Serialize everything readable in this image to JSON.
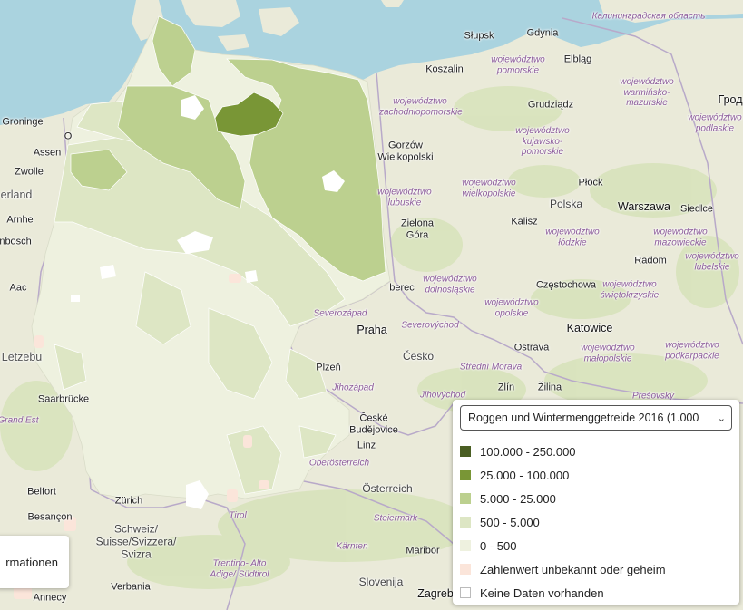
{
  "colors": {
    "sea": "#aad3df",
    "land": "#eaead9",
    "forest": "#d2dfb4",
    "class1": "#4a5e23",
    "class2": "#799636",
    "class3": "#bcd08f",
    "class4": "#dde6c4",
    "class5": "#eef1df",
    "unknown": "#fbe5da",
    "nodata": "#ffffff",
    "border": "#b8a9c9"
  },
  "legend": {
    "selected_dataset": "Roggen und Wintermenggetreide 2016 (1.000",
    "chevron_icon": "chevron-down-icon",
    "items": [
      {
        "label": "100.000 - 250.000",
        "color": "#4a5e23"
      },
      {
        "label": "25.000 - 100.000",
        "color": "#799636"
      },
      {
        "label": "5.000 - 25.000",
        "color": "#bcd08f"
      },
      {
        "label": "500 - 5.000",
        "color": "#dde6c4"
      },
      {
        "label": "0 - 500",
        "color": "#eef1df"
      },
      {
        "label": "Zahlenwert unbekannt oder geheim",
        "color": "#fbe5da"
      },
      {
        "label": "Keine Daten vorhanden",
        "color": "#ffffff"
      }
    ]
  },
  "info_button": {
    "label": "rmationen"
  },
  "map_labels": {
    "kaliningrad": "Калининградская область",
    "slupsk": "Słupsk",
    "gdynia": "Gdynia",
    "koszalin": "Koszalin",
    "woj_pomorskie": "województwo pomorskie",
    "elblag": "Elbląg",
    "woj_warminsko": "województwo warmińsko-mazurskie",
    "grod": "Грод",
    "woj_zachodnio": "województwo zachodniopomorskie",
    "grudziadz": "Grudziądz",
    "woj_podlaskie": "województwo podlaskie",
    "groningen": "Groninge",
    "o": "O",
    "assen": "Assen",
    "gorzow": "Gorzów Wielkopolski",
    "woj_kujawsko": "województwo kujawsko-pomorskie",
    "zwolle": "Zwolle",
    "plock": "Płock",
    "erland": "erland",
    "woj_lubuskie": "województwo lubuskie",
    "woj_wielkopolskie": "województwo wielkopolskie",
    "polska": "Polska",
    "warszawa": "Warszawa",
    "siedlce": "Siedlce",
    "arnhem": "Arnhe",
    "kalisz": "Kalisz",
    "zielona": "Zielona Góra",
    "woj_lodzkie": "województwo łódzkie",
    "enbosch": "enbosch",
    "woj_mazowieckie": "województwo mazowieckie",
    "radom": "Radom",
    "woj_lubelskie": "województwo lubelskie",
    "aac": "Aac",
    "woj_dolnoslaskie": "województwo dolnośląskie",
    "czestochowa": "Częstochowa",
    "berec": "berec",
    "woj_opolskie": "województwo opolskie",
    "woj_swietokrzyskie": "województwo świętokrzyskie",
    "severozapad": "Severozápad",
    "severovychod": "Severovýchod",
    "praha": "Praha",
    "katowice": "Katowice",
    "letzebu": "Lëtzebu",
    "cesko": "Česko",
    "ostrava": "Ostrava",
    "woj_malopolskie": "województwo małopolskie",
    "woj_podkarpackie": "województwo podkarpackie",
    "plzen": "Plzeň",
    "stredni_morava": "Střední Morava",
    "jihozapad": "Jihozápad",
    "zlin": "Zlín",
    "zilina": "Žilina",
    "jihovychod": "Jihovýchod",
    "presovsky": "Prešovský",
    "saarbrucken": "Saarbrücke",
    "grand_est": "Grand Est",
    "ceske_budejovice": "České Budějovice",
    "linz": "Linz",
    "oberosterreich": "Oberösterreich",
    "belfort": "Belfort",
    "osterreich": "Österreich",
    "zurich": "Zürich",
    "besancon": "Besançon",
    "steiermark": "Steiermark",
    "tirol": "Tirol",
    "schweiz": "Schweiz/ Suisse/Svizzera/ Svizra",
    "karnten": "Kärnten",
    "maribor": "Maribor",
    "trentino": "Trentino- Alto Adige/ Südtirol",
    "slovenija": "Slovenija",
    "verbania": "Verbania",
    "annecy": "Annecy",
    "zagreb": "Zagreb"
  }
}
